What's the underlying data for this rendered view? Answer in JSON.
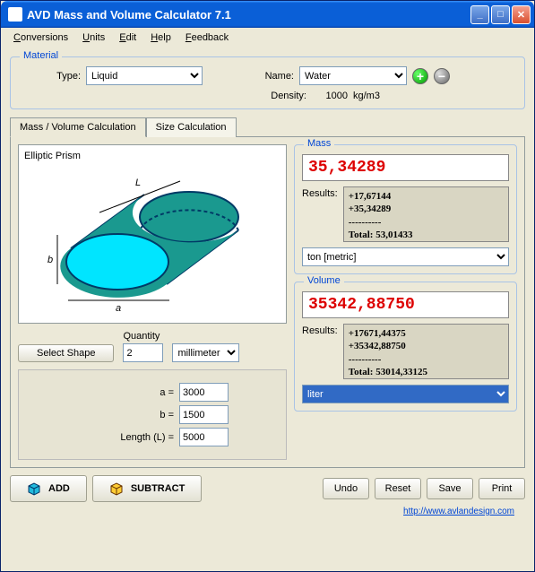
{
  "window": {
    "title": "AVD Mass and Volume Calculator 7.1"
  },
  "menu": {
    "conversions": "Conversions",
    "units": "Units",
    "edit": "Edit",
    "help": "Help",
    "feedback": "Feedback"
  },
  "material": {
    "legend": "Material",
    "type_label": "Type:",
    "type_value": "Liquid",
    "name_label": "Name:",
    "name_value": "Water",
    "density_label": "Density:",
    "density_value": "1000",
    "density_unit": "kg/m3"
  },
  "tabs": {
    "mass_volume": "Mass / Volume  Calculation",
    "size": "Size Calculation"
  },
  "shape": {
    "title": "Elliptic Prism",
    "select_btn": "Select Shape",
    "quantity_label": "Quantity",
    "quantity_value": "2",
    "length_unit": "millimeter",
    "label_a": "a",
    "label_b": "b",
    "label_L": "L",
    "param_a_label": "a =",
    "param_a_value": "3000",
    "param_b_label": "b =",
    "param_b_value": "1500",
    "param_L_label": "Length (L) =",
    "param_L_value": "5000"
  },
  "mass": {
    "legend": "Mass",
    "value": "35,34289",
    "results_label": "Results:",
    "results_text": "+17,67144\n+35,34289\n----------\nTotal: 53,01433",
    "unit": "ton [metric]"
  },
  "volume": {
    "legend": "Volume",
    "value": "35342,88750",
    "results_label": "Results:",
    "results_text": "+17671,44375\n+35342,88750\n----------\nTotal: 53014,33125",
    "unit": "liter"
  },
  "buttons": {
    "add": "ADD",
    "subtract": "SUBTRACT",
    "undo": "Undo",
    "reset": "Reset",
    "save": "Save",
    "print": "Print"
  },
  "footer": {
    "link": "http://www.avlandesign.com"
  }
}
